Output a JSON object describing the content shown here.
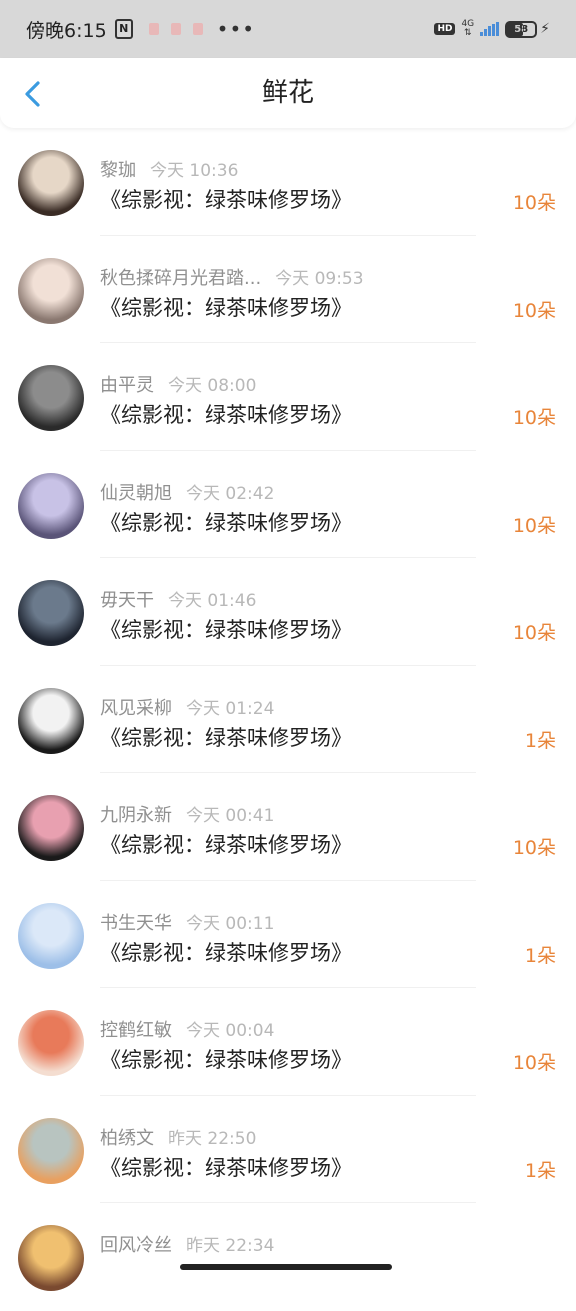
{
  "status_bar": {
    "time": "傍晚6:15",
    "network": "4G",
    "hd": "HD",
    "battery": "58",
    "battery_level_percent": 58
  },
  "nav": {
    "title": "鲜花",
    "back_icon": "chevron-left-icon",
    "accent_color": "#3b9be0"
  },
  "accent": {
    "count_color": "#e8853a"
  },
  "items": [
    {
      "name": "黎珈",
      "time": "今天 10:36",
      "book": "《综影视：绿茶味修罗场》",
      "count": "10朵",
      "avatar_colors": [
        "#e6d7c7",
        "#3a2c25"
      ]
    },
    {
      "name": "秋色揉碎月光君踏...",
      "time": "今天 09:53",
      "book": "《综影视：绿茶味修罗场》",
      "count": "10朵",
      "avatar_colors": [
        "#f1e0d6",
        "#8a7870"
      ]
    },
    {
      "name": "由平灵",
      "time": "今天 08:00",
      "book": "《综影视：绿茶味修罗场》",
      "count": "10朵",
      "avatar_colors": [
        "#8c8c8c",
        "#2a2a2a"
      ]
    },
    {
      "name": "仙灵朝旭",
      "time": "今天 02:42",
      "book": "《综影视：绿茶味修罗场》",
      "count": "10朵",
      "avatar_colors": [
        "#c8c2e6",
        "#5a5478"
      ]
    },
    {
      "name": "毋天干",
      "time": "今天 01:46",
      "book": "《综影视：绿茶味修罗场》",
      "count": "10朵",
      "avatar_colors": [
        "#6b7a8c",
        "#1e2430"
      ]
    },
    {
      "name": "风见采柳",
      "time": "今天 01:24",
      "book": "《综影视：绿茶味修罗场》",
      "count": "1朵",
      "avatar_colors": [
        "#f2f2f2",
        "#1a1a1a"
      ]
    },
    {
      "name": "九阴永新",
      "time": "今天 00:41",
      "book": "《综影视：绿茶味修罗场》",
      "count": "10朵",
      "avatar_colors": [
        "#e8a0b0",
        "#1a1a1a"
      ]
    },
    {
      "name": "书生天华",
      "time": "今天 00:11",
      "book": "《综影视：绿茶味修罗场》",
      "count": "1朵",
      "avatar_colors": [
        "#dbe8f8",
        "#9dbfe8"
      ]
    },
    {
      "name": "控鹤红敏",
      "time": "今天 00:04",
      "book": "《综影视：绿茶味修罗场》",
      "count": "10朵",
      "avatar_colors": [
        "#e87a5a",
        "#f4ddd0"
      ]
    },
    {
      "name": "柏绣文",
      "time": "昨天 22:50",
      "book": "《综影视：绿茶味修罗场》",
      "count": "1朵",
      "avatar_colors": [
        "#b8c4c0",
        "#e8a060"
      ]
    },
    {
      "name": "回风冷丝",
      "time": "昨天 22:34",
      "book": "",
      "count": "",
      "avatar_colors": [
        "#f0c070",
        "#7a4a30"
      ]
    }
  ]
}
